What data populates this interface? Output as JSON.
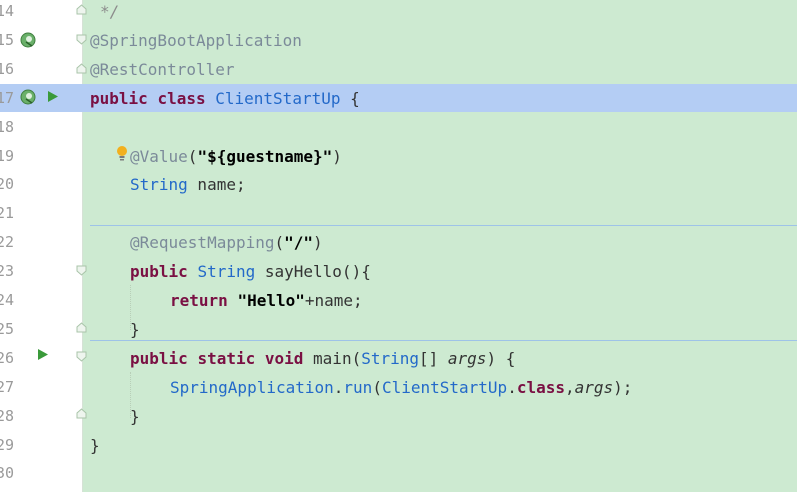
{
  "editor": {
    "lines": [
      {
        "num": "14",
        "segments": [
          {
            "t": "*/",
            "c": "cm"
          }
        ]
      },
      {
        "num": "15",
        "segments": [
          {
            "t": "@SpringBootApplication",
            "c": "ann"
          }
        ]
      },
      {
        "num": "16",
        "segments": [
          {
            "t": "@RestController",
            "c": "ann"
          }
        ]
      },
      {
        "num": "17",
        "segments": [
          {
            "t": "public",
            "c": "kw"
          },
          {
            "t": " ",
            "c": "plain"
          },
          {
            "t": "class",
            "c": "kw"
          },
          {
            "t": " ",
            "c": "plain"
          },
          {
            "t": "ClientStartUp",
            "c": "ty"
          },
          {
            "t": " {",
            "c": "plain"
          }
        ]
      },
      {
        "num": "18",
        "segments": []
      },
      {
        "num": "19",
        "segments": [
          {
            "t": "@Value",
            "c": "ann"
          },
          {
            "t": "(",
            "c": "plain"
          },
          {
            "t": "\"${guestname}\"",
            "c": "str"
          },
          {
            "t": ")",
            "c": "plain"
          }
        ]
      },
      {
        "num": "20",
        "segments": [
          {
            "t": "String",
            "c": "ty"
          },
          {
            "t": " name;",
            "c": "plain"
          }
        ]
      },
      {
        "num": "21",
        "segments": []
      },
      {
        "num": "22",
        "segments": [
          {
            "t": "@RequestMapping",
            "c": "ann"
          },
          {
            "t": "(",
            "c": "plain"
          },
          {
            "t": "\"/\"",
            "c": "str"
          },
          {
            "t": ")",
            "c": "plain"
          }
        ]
      },
      {
        "num": "23",
        "segments": [
          {
            "t": "public",
            "c": "kw"
          },
          {
            "t": " ",
            "c": "plain"
          },
          {
            "t": "String",
            "c": "ty"
          },
          {
            "t": " sayHello(){",
            "c": "plain"
          }
        ]
      },
      {
        "num": "24",
        "segments": [
          {
            "t": "return",
            "c": "kw"
          },
          {
            "t": " ",
            "c": "plain"
          },
          {
            "t": "\"Hello\"",
            "c": "str"
          },
          {
            "t": "+name;",
            "c": "plain"
          }
        ]
      },
      {
        "num": "25",
        "segments": [
          {
            "t": "}",
            "c": "plain"
          }
        ]
      },
      {
        "num": "26",
        "segments": [
          {
            "t": "public",
            "c": "kw"
          },
          {
            "t": " ",
            "c": "plain"
          },
          {
            "t": "static",
            "c": "kw"
          },
          {
            "t": " ",
            "c": "plain"
          },
          {
            "t": "void",
            "c": "kw"
          },
          {
            "t": " main(",
            "c": "plain"
          },
          {
            "t": "String",
            "c": "ty"
          },
          {
            "t": "[] ",
            "c": "plain"
          },
          {
            "t": "args",
            "c": "it"
          },
          {
            "t": ") {",
            "c": "plain"
          }
        ]
      },
      {
        "num": "27",
        "segments": [
          {
            "t": "SpringApplication",
            "c": "ty"
          },
          {
            "t": ".",
            "c": "plain"
          },
          {
            "t": "run",
            "c": "ty"
          },
          {
            "t": "(",
            "c": "plain"
          },
          {
            "t": "ClientStartUp",
            "c": "ty"
          },
          {
            "t": ".",
            "c": "plain"
          },
          {
            "t": "class",
            "c": "kw"
          },
          {
            "t": ",",
            "c": "plain"
          },
          {
            "t": "args",
            "c": "it"
          },
          {
            "t": ");",
            "c": "plain"
          }
        ]
      },
      {
        "num": "28",
        "segments": [
          {
            "t": "}",
            "c": "plain"
          }
        ]
      },
      {
        "num": "29",
        "segments": [
          {
            "t": "}",
            "c": "plain"
          }
        ]
      },
      {
        "num": "30",
        "segments": []
      }
    ],
    "current_line": "17",
    "gutter_icons": {
      "spring_bean": "spring-bean-icon",
      "run": "run-icon",
      "intention": "lightbulb-icon",
      "fold": "fold-marker-icon"
    },
    "colors": {
      "background": "#cdead1",
      "current_line": "#b4cdf4",
      "keyword": "#7a1043",
      "type": "#2369c9",
      "annotation": "#7b8a99",
      "run_green": "#3a9a3a"
    }
  }
}
